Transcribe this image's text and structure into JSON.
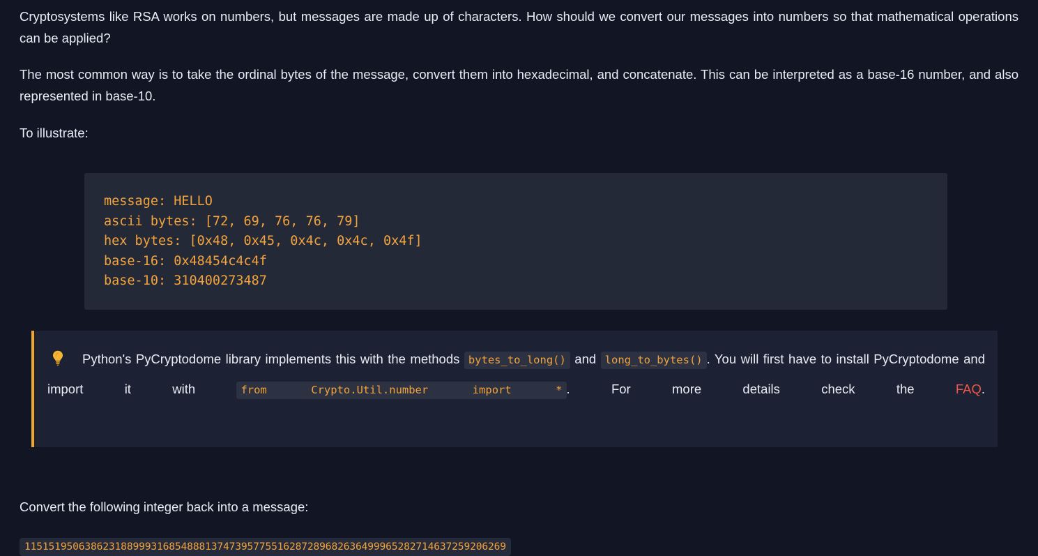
{
  "theme": {
    "page_bg": "#111524",
    "code_bg": "#242938",
    "callout_bg": "#1c2233",
    "accent_border": "#f0a62c",
    "code_text": "#f3a33c",
    "body_text": "#e9ecf4",
    "link_color": "#f0564a"
  },
  "body": {
    "paragraph_1": "Cryptosystems like RSA works on numbers, but messages are made up of characters. How should we convert our messages into numbers so that mathematical operations can be applied?",
    "paragraph_2": "The most common way is to take the ordinal bytes of the message, convert them into hexadecimal, and concatenate. This can be interpreted as a base-16 number, and also represented in base-10.",
    "paragraph_3": "To illustrate:"
  },
  "code_block": {
    "lines": [
      "message: HELLO",
      "ascii bytes: [72, 69, 76, 76, 79]",
      "hex bytes: [0x48, 0x45, 0x4c, 0x4c, 0x4f]",
      "base-16: 0x48454c4c4f",
      "base-10: 310400273487"
    ],
    "text": "message: HELLO\nascii bytes: [72, 69, 76, 76, 79]\nhex bytes: [0x48, 0x45, 0x4c, 0x4c, 0x4f]\nbase-16: 0x48454c4c4f\nbase-10: 310400273487"
  },
  "callout": {
    "icon": "lightbulb-icon",
    "text_1": "Python's PyCryptodome library implements this with the methods ",
    "code_1": "bytes_to_long()",
    "text_2": " and ",
    "code_2": "long_to_bytes()",
    "text_3": ". You will first have to install PyCryptodome and import it with ",
    "code_3": "from Crypto.Util.number import *",
    "text_4": ". For more details check the ",
    "link_label": "FAQ",
    "text_5": "."
  },
  "question": {
    "prompt": "Convert the following integer back into a message:",
    "integer": "11515195063862318899931685488813747395775516287289682636499965282714637259206269"
  }
}
